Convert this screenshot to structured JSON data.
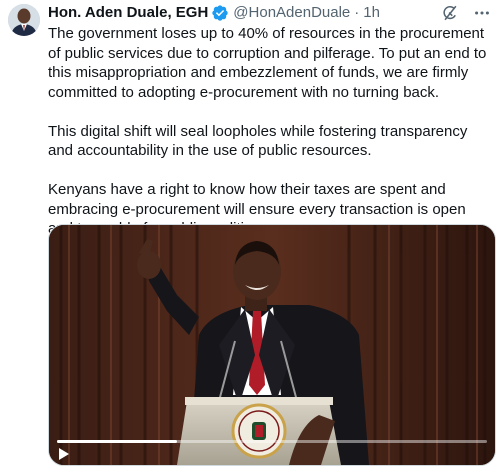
{
  "tweet": {
    "author": {
      "display_name": "Hon. Aden Duale, EGH",
      "handle": "@HonAdenDuale",
      "separator": "·",
      "time": "1h"
    },
    "paragraphs": [
      "The government loses up to 40% of resources in the procurement of public services due to corruption and pilferage. To put an end to this misappropriation and embezzlement of funds, we are firmly committed to adopting e-procurement with no turning back.",
      "This digital shift will seal loopholes while fostering transparency and accountability in the use of public resources.",
      "Kenyans have a right to know how their taxes are spent and embracing e-procurement will ensure every transaction is open and traceable for public auditing."
    ],
    "video": {
      "progress_fraction": 0.28
    }
  },
  "icons": {
    "verified": "verified-badge-icon",
    "grok": "grok-icon",
    "more": "more-icon",
    "play": "play-icon",
    "seal": "coat-of-arms-icon"
  },
  "colors": {
    "text": "#0f1419",
    "secondary": "#536471",
    "verified": "#1d9bf0",
    "border": "#cfd9de"
  }
}
